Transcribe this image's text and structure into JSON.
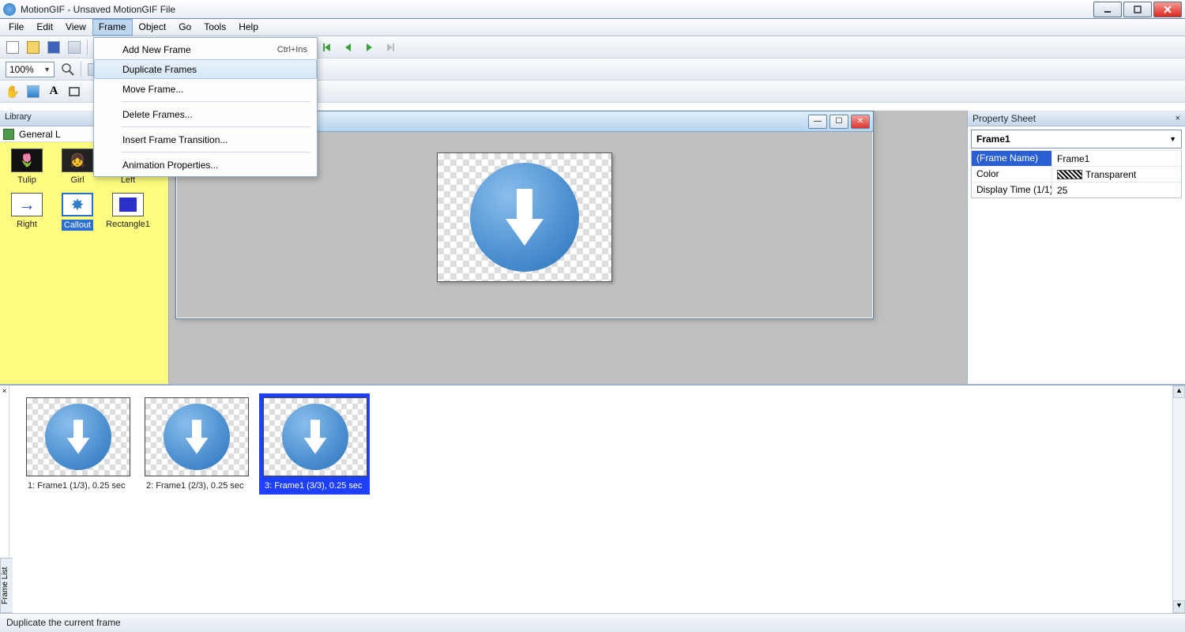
{
  "window": {
    "title": "MotionGIF - Unsaved MotionGIF File"
  },
  "menubar": [
    "File",
    "Edit",
    "View",
    "Frame",
    "Object",
    "Go",
    "Tools",
    "Help"
  ],
  "active_menu_index": 3,
  "dropdown": {
    "items": [
      {
        "label": "Add New Frame",
        "shortcut": "Ctrl+Ins",
        "sep": false
      },
      {
        "label": "Duplicate Frames",
        "shortcut": "",
        "sep": false,
        "hovered": true
      },
      {
        "label": "Move Frame...",
        "shortcut": "",
        "sep": false
      },
      {
        "sep": true
      },
      {
        "label": "Delete Frames...",
        "shortcut": "",
        "sep": false
      },
      {
        "sep": true
      },
      {
        "label": "Insert Frame Transition...",
        "shortcut": "",
        "sep": false
      },
      {
        "sep": true
      },
      {
        "label": "Animation Properties...",
        "shortcut": "",
        "sep": false
      }
    ]
  },
  "toolbar2": {
    "zoom": "100%"
  },
  "library": {
    "title": "Library",
    "category": "General L",
    "items": [
      {
        "name": "Tulip",
        "glyph": "🌷"
      },
      {
        "name": "Girl",
        "glyph": "👧"
      },
      {
        "name": "Left",
        "glyph": "←"
      },
      {
        "name": "Right",
        "glyph": "→"
      },
      {
        "name": "Callout",
        "glyph": "✸",
        "selected": true
      },
      {
        "name": "Rectangle1",
        "glyph": "■"
      }
    ]
  },
  "property_sheet": {
    "title": "Property Sheet",
    "subject": "Frame1",
    "rows": [
      {
        "key": "(Frame Name)",
        "value": "Frame1",
        "selected": true
      },
      {
        "key": "Color",
        "value": "Transparent",
        "swatch": true
      },
      {
        "key": "Display Time (1/1)",
        "value": "25"
      }
    ]
  },
  "frame_list": {
    "tab_label": "Frame List",
    "close_glyph": "×",
    "frames": [
      {
        "caption": "1: Frame1 (1/3), 0.25 sec"
      },
      {
        "caption": "2: Frame1 (2/3), 0.25 sec"
      },
      {
        "caption": "3: Frame1 (3/3), 0.25 sec",
        "selected": true
      }
    ]
  },
  "statusbar": {
    "text": "Duplicate the current frame"
  }
}
